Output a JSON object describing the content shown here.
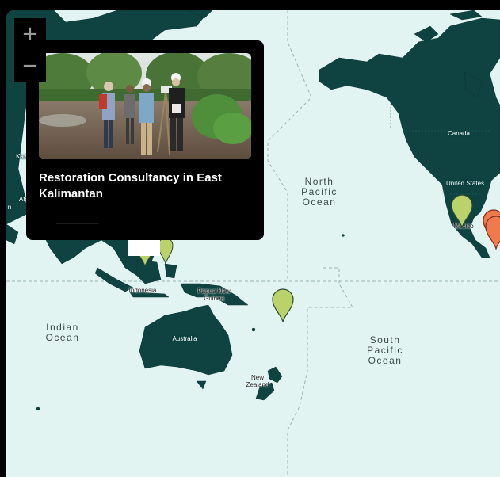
{
  "map": {
    "zoom_in_label": "+",
    "zoom_out_label": "−",
    "ocean_labels": {
      "north_pacific": "North\nPacific\nOcean",
      "south_pacific": "South\nPacific\nOcean",
      "indian": "Indian\nOcean"
    },
    "place_labels": {
      "canada": "Canada",
      "united_states": "United States",
      "mexico": "Mexico",
      "indonesia": "Indonesia",
      "papua_new_guinea": "Papua New\nGuinea",
      "australia": "Australia",
      "new_zealand": "New\nZealand",
      "kaz": "Kaz",
      "afg": "Afg",
      "n": "n"
    },
    "colors": {
      "ocean": "#e2f4f1",
      "land": "#0e4341",
      "marker_green": "#b9d36a",
      "marker_orange": "#f07a4d"
    }
  },
  "popup": {
    "title": "Restoration Consultancy in East Kalimantan",
    "photo_icon": "field-survey-photo"
  }
}
